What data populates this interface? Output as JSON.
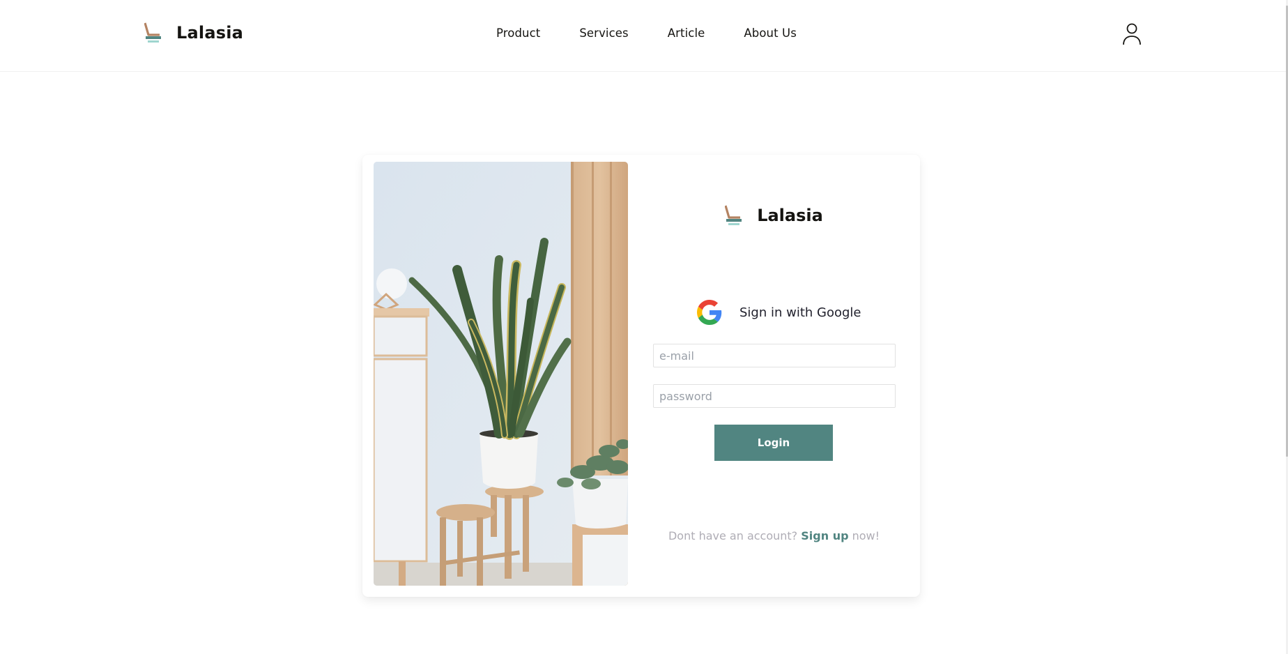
{
  "header": {
    "brand_name": "Lalasia",
    "nav": [
      {
        "label": "Product"
      },
      {
        "label": "Services"
      },
      {
        "label": "Article"
      },
      {
        "label": "About Us"
      }
    ],
    "user_icon": "user-icon"
  },
  "login_card": {
    "image_alt": "Snake plant in white pot on wooden stool beside cabinet and wood slat wall",
    "brand_name": "Lalasia",
    "google_button_label": "Sign in with Google",
    "email": {
      "value": "",
      "placeholder": "e-mail"
    },
    "password": {
      "value": "",
      "placeholder": "password"
    },
    "login_button_label": "Login",
    "signup": {
      "prefix": "Dont have an account? ",
      "link_label": "Sign up",
      "suffix": " now!"
    }
  },
  "colors": {
    "accent": "#518581",
    "logo_brown": "#b48362",
    "logo_light_teal": "#9fd5cf",
    "text_dark": "#151411",
    "muted_text": "#afadb5"
  }
}
